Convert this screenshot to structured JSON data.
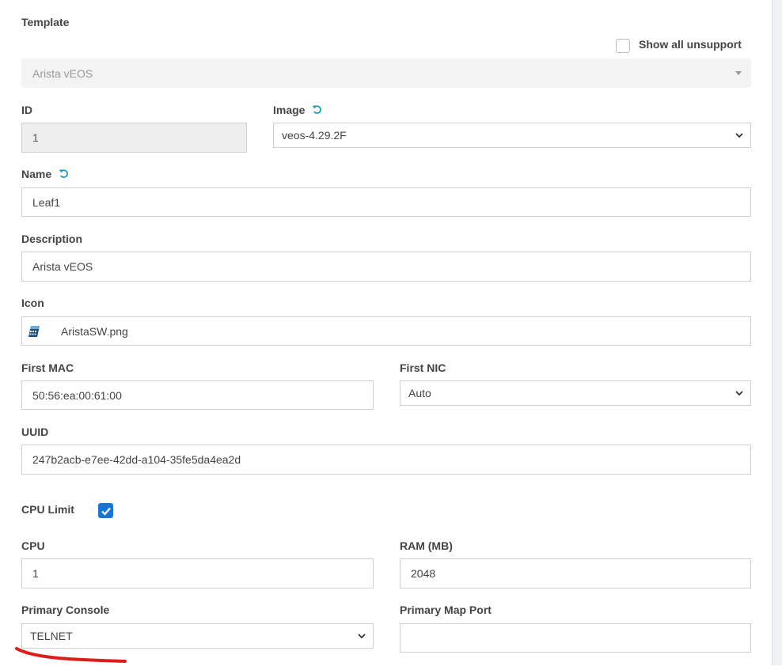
{
  "template": {
    "label": "Template",
    "show_unsupported_label": "Show all unsupport",
    "show_unsupported_checked": false,
    "selected": "Arista vEOS"
  },
  "id": {
    "label": "ID",
    "value": "1"
  },
  "image": {
    "label": "Image",
    "value": "veos-4.29.2F"
  },
  "name": {
    "label": "Name",
    "value": "Leaf1"
  },
  "description": {
    "label": "Description",
    "value": "Arista vEOS"
  },
  "icon": {
    "label": "Icon",
    "value": "AristaSW.png"
  },
  "first_mac": {
    "label": "First MAC",
    "value": "50:56:ea:00:61:00"
  },
  "first_nic": {
    "label": "First NIC",
    "value": "Auto"
  },
  "uuid": {
    "label": "UUID",
    "value": "247b2acb-e7ee-42dd-a104-35fe5da4ea2d"
  },
  "cpu_limit": {
    "label": "CPU Limit",
    "checked": true
  },
  "cpu": {
    "label": "CPU",
    "value": "1"
  },
  "ram": {
    "label": "RAM (MB)",
    "value": "2048"
  },
  "primary_console": {
    "label": "Primary Console",
    "value": "TELNET"
  },
  "primary_map_port": {
    "label": "Primary Map Port",
    "value": ""
  },
  "colors": {
    "accent": "#1976d2",
    "refresh_icon": "#17a2c8",
    "annotation": "#e01b1b"
  }
}
